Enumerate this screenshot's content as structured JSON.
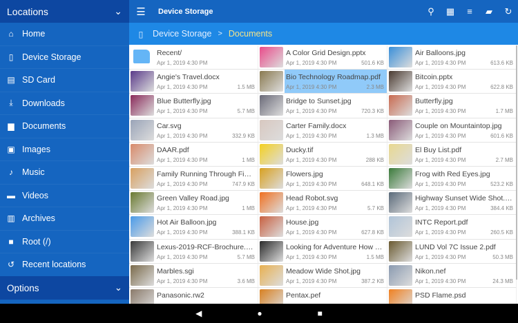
{
  "sidebar": {
    "header": "Locations",
    "options": "Options",
    "items": [
      {
        "label": "Home",
        "icon": "home-icon",
        "glyph": "⌂"
      },
      {
        "label": "Device Storage",
        "icon": "phone-icon",
        "glyph": "▯"
      },
      {
        "label": "SD Card",
        "icon": "sd-card-icon",
        "glyph": "▤"
      },
      {
        "label": "Downloads",
        "icon": "download-icon",
        "glyph": "⤓"
      },
      {
        "label": "Documents",
        "icon": "document-icon",
        "glyph": "▆"
      },
      {
        "label": "Images",
        "icon": "image-icon",
        "glyph": "▣"
      },
      {
        "label": "Music",
        "icon": "music-icon",
        "glyph": "♪"
      },
      {
        "label": "Videos",
        "icon": "video-icon",
        "glyph": "▬"
      },
      {
        "label": "Archives",
        "icon": "archive-icon",
        "glyph": "▥"
      },
      {
        "label": "Root (/)",
        "icon": "folder-icon",
        "glyph": "■"
      },
      {
        "label": "Recent locations",
        "icon": "history-icon",
        "glyph": "↺"
      }
    ]
  },
  "toolbar": {
    "title": "Device Storage"
  },
  "breadcrumb": {
    "root": "Device Storage",
    "separator": ">",
    "current": "Documents"
  },
  "files": [
    {
      "name": "Recent/",
      "date": "Apr 1, 2019 4:30 PM",
      "size": "",
      "color": "#64b5f6"
    },
    {
      "name": "A Color Grid Design.pptx",
      "date": "Apr 1, 2019 4:30 PM",
      "size": "501.6 KB",
      "color": "#e94b8a"
    },
    {
      "name": "Air Balloons.jpg",
      "date": "Apr 1, 2019 4:30 PM",
      "size": "613.6 KB",
      "color": "#3a8fd8"
    },
    {
      "name": "Angie's Travel.docx",
      "date": "Apr 1, 2019 4:30 PM",
      "size": "1.5 MB",
      "color": "#5a3a8a"
    },
    {
      "name": "Bio Technology Roadmap.pdf",
      "date": "Apr 1, 2019 4:30 PM",
      "size": "2.3 MB",
      "color": "#8a7a50",
      "selected": true
    },
    {
      "name": "Bitcoin.pptx",
      "date": "Apr 1, 2019 4:30 PM",
      "size": "622.8 KB",
      "color": "#4a3a30"
    },
    {
      "name": "Blue Butterfly.jpg",
      "date": "Apr 1, 2019 4:30 PM",
      "size": "5.7 MB",
      "color": "#8a2a5a"
    },
    {
      "name": "Bridge to Sunset.jpg",
      "date": "Apr 1, 2019 4:30 PM",
      "size": "720.3 KB",
      "color": "#6a6a78"
    },
    {
      "name": "Butterfly.jpg",
      "date": "Apr 1, 2019 4:30 PM",
      "size": "1.7 MB",
      "color": "#c86a50"
    },
    {
      "name": "Car.svg",
      "date": "Apr 1, 2019 4:30 PM",
      "size": "332.9 KB",
      "color": "#9aa4b8"
    },
    {
      "name": "Carter Family.docx",
      "date": "Apr 1, 2019 4:30 PM",
      "size": "1.3 MB",
      "color": "#d8c8c0"
    },
    {
      "name": "Couple on Mountaintop.jpg",
      "date": "Apr 1, 2019 4:30 PM",
      "size": "601.6 KB",
      "color": "#8a5a78"
    },
    {
      "name": "DAAR.pdf",
      "date": "Apr 1, 2019 4:30 PM",
      "size": "1 MB",
      "color": "#d88a6a"
    },
    {
      "name": "Ducky.tif",
      "date": "Apr 1, 2019 4:30 PM",
      "size": "288 KB",
      "color": "#f4d020"
    },
    {
      "name": "El Buy List.pdf",
      "date": "Apr 1, 2019 4:30 PM",
      "size": "2.7 MB",
      "color": "#e8d890"
    },
    {
      "name": "Family Running Through Fiel...",
      "date": "Apr 1, 2019 4:30 PM",
      "size": "747.9 KB",
      "color": "#d8a060"
    },
    {
      "name": "Flowers.jpg",
      "date": "Apr 1, 2019 4:30 PM",
      "size": "648.1 KB",
      "color": "#d8a020"
    },
    {
      "name": "Frog with Red Eyes.jpg",
      "date": "Apr 1, 2019 4:30 PM",
      "size": "523.2 KB",
      "color": "#3a7a3a"
    },
    {
      "name": "Green Valley Road.jpg",
      "date": "Apr 1, 2019 4:30 PM",
      "size": "1 MB",
      "color": "#6a7a30"
    },
    {
      "name": "Head Robot.svg",
      "date": "Apr 1, 2019 4:30 PM",
      "size": "5.7 KB",
      "color": "#f07020"
    },
    {
      "name": "Highway Sunset Wide Shot.jpg",
      "date": "Apr 1, 2019 4:30 PM",
      "size": "384.4 KB",
      "color": "#5a6a7a"
    },
    {
      "name": "Hot Air Balloon.jpg",
      "date": "Apr 1, 2019 4:30 PM",
      "size": "388.1 KB",
      "color": "#4a9ae8"
    },
    {
      "name": "House.jpg",
      "date": "Apr 1, 2019 4:30 PM",
      "size": "627.8 KB",
      "color": "#c86040"
    },
    {
      "name": "INTC Report.pdf",
      "date": "Apr 1, 2019 4:30 PM",
      "size": "260.5 KB",
      "color": "#b0c4d8"
    },
    {
      "name": "Lexus-2019-RCF-Brochure.pdf",
      "date": "Apr 1, 2019 4:30 PM",
      "size": "5.7 MB",
      "color": "#3a3a3a"
    },
    {
      "name": "Looking for Adventure How T...",
      "date": "Apr 1, 2019 4:30 PM",
      "size": "1.5 MB",
      "color": "#2a2a2a"
    },
    {
      "name": "LUND Vol 7C Issue 2.pdf",
      "date": "Apr 1, 2019 4:30 PM",
      "size": "50.3 MB",
      "color": "#6a5a30"
    },
    {
      "name": "Marbles.sgi",
      "date": "Apr 1, 2019 4:30 PM",
      "size": "3.6 MB",
      "color": "#7a6a4a"
    },
    {
      "name": "Meadow Wide Shot.jpg",
      "date": "Apr 1, 2019 4:30 PM",
      "size": "387.2 KB",
      "color": "#e8b050"
    },
    {
      "name": "Nikon.nef",
      "date": "Apr 1, 2019 4:30 PM",
      "size": "24.3 MB",
      "color": "#8a9ab0"
    },
    {
      "name": "Panasonic.rw2",
      "date": "",
      "size": "",
      "color": "#8a7a6a"
    },
    {
      "name": "Pentax.pef",
      "date": "",
      "size": "",
      "color": "#d88020"
    },
    {
      "name": "PSD Flame.psd",
      "date": "",
      "size": "",
      "color": "#f08020"
    }
  ],
  "nav": {
    "back": "◀",
    "home": "●",
    "recents": "■"
  }
}
